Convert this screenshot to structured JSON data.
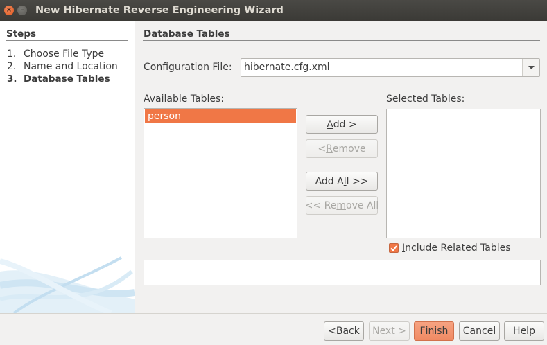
{
  "window": {
    "title": "New Hibernate Reverse Engineering Wizard"
  },
  "steps": {
    "title": "Steps",
    "items": [
      {
        "num": "1.",
        "label": "Choose File Type"
      },
      {
        "num": "2.",
        "label": "Name and Location"
      },
      {
        "num": "3.",
        "label": "Database Tables"
      }
    ]
  },
  "panel": {
    "title": "Database Tables",
    "config": {
      "label_mnemonic": "C",
      "label_rest": "onfiguration File:",
      "value": "hibernate.cfg.xml"
    },
    "available": {
      "label_pre": "Available ",
      "label_mnemonic": "T",
      "label_post": "ables:",
      "items": [
        "person"
      ]
    },
    "selected": {
      "label_pre": "S",
      "label_mnemonic": "e",
      "label_post": "lected Tables:"
    },
    "buttons": {
      "add": {
        "mn": "A",
        "rest": "dd >"
      },
      "remove": {
        "pre": "< ",
        "mn": "R",
        "rest": "emove"
      },
      "add_all": {
        "pre": "Add A",
        "mn": "l",
        "rest": "l >>"
      },
      "remove_all": {
        "pre": "<< Re",
        "mn": "m",
        "rest": "ove All"
      }
    },
    "include_related": {
      "label_mnemonic": "I",
      "label_rest": "nclude Related Tables",
      "checked": true
    }
  },
  "footer": {
    "back": {
      "pre": "< ",
      "mn": "B",
      "rest": "ack"
    },
    "next": "Next >",
    "finish": {
      "mn": "F",
      "rest": "inish"
    },
    "cancel": "Cancel",
    "help": {
      "mn": "H",
      "rest": "elp"
    }
  },
  "colors": {
    "accent": "#f07746",
    "titlebar": "#3c3b37",
    "background": "#f2f1f0"
  }
}
